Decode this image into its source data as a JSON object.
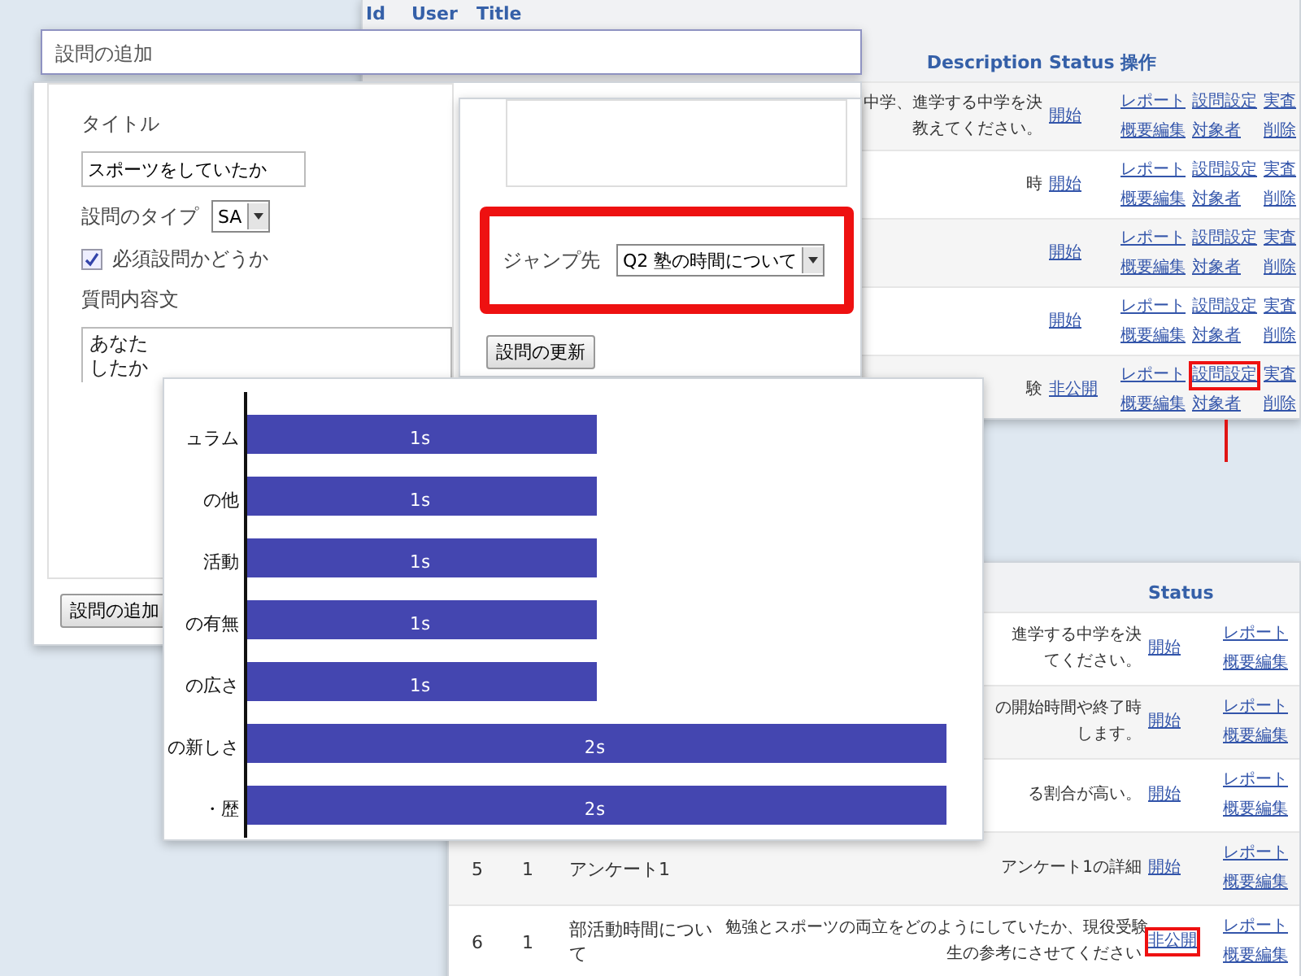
{
  "back_table": {
    "columns": [
      "Id",
      "User",
      "Title",
      "Description",
      "Status",
      "操作"
    ],
    "rows": [
      {
        "description": [
          "中学、進学する中学を決",
          "教えてください。"
        ],
        "status": {
          "label": "開始",
          "highlighted": false
        },
        "actions": [
          {
            "label": "レポート",
            "highlighted": false
          },
          {
            "label": "概要編集",
            "highlighted": false
          },
          {
            "label": "設問設定",
            "highlighted": false
          },
          {
            "label": "対象者",
            "highlighted": false
          },
          {
            "label": "実査",
            "highlighted": false
          },
          {
            "label": "削除",
            "highlighted": false
          }
        ]
      },
      {
        "description": [
          "時"
        ],
        "status": {
          "label": "開始",
          "highlighted": false
        },
        "actions": [
          {
            "label": "レポート",
            "highlighted": false
          },
          {
            "label": "概要編集",
            "highlighted": false
          },
          {
            "label": "設問設定",
            "highlighted": false
          },
          {
            "label": "対象者",
            "highlighted": false
          },
          {
            "label": "実査",
            "highlighted": false
          },
          {
            "label": "削除",
            "highlighted": false
          }
        ]
      },
      {
        "status": {
          "label": "開始",
          "highlighted": false
        },
        "actions": [
          {
            "label": "レポート",
            "highlighted": false
          },
          {
            "label": "概要編集",
            "highlighted": false
          },
          {
            "label": "設問設定",
            "highlighted": false
          },
          {
            "label": "対象者",
            "highlighted": false
          },
          {
            "label": "実査",
            "highlighted": false
          },
          {
            "label": "削除",
            "highlighted": false
          }
        ]
      },
      {
        "status": {
          "label": "開始",
          "highlighted": false
        },
        "actions": [
          {
            "label": "レポート",
            "highlighted": false
          },
          {
            "label": "概要編集",
            "highlighted": false
          },
          {
            "label": "設問設定",
            "highlighted": false
          },
          {
            "label": "対象者",
            "highlighted": false
          },
          {
            "label": "実査",
            "highlighted": false
          },
          {
            "label": "削除",
            "highlighted": false
          }
        ]
      },
      {
        "description": [
          "験"
        ],
        "status": {
          "label": "非公開",
          "highlighted": false
        },
        "actions": [
          {
            "label": "レポート",
            "highlighted": false
          },
          {
            "label": "概要編集",
            "highlighted": false
          },
          {
            "label": "設問設定",
            "highlighted": true
          },
          {
            "label": "対象者",
            "highlighted": false
          },
          {
            "label": "実査",
            "highlighted": false
          },
          {
            "label": "削除",
            "highlighted": false
          }
        ]
      }
    ]
  },
  "add_question_panel": {
    "title": "設問の追加"
  },
  "question_form": {
    "title_label": "タイトル",
    "title_value": "スポーツをしていたか",
    "type_label": "設問のタイプ",
    "type_value": "SA",
    "required": {
      "label": "必須設問かどうか",
      "checked": true
    },
    "text_label": "質問内容文",
    "text_lines": [
      "あなた",
      "したか"
    ],
    "add_button": "設問の追加"
  },
  "jump_panel": {
    "label": "ジャンプ先",
    "value": "Q2 塾の時間について",
    "highlighted": true,
    "update_button": "設問の更新"
  },
  "chart_panel": {
    "chart_data": {
      "type": "bar",
      "orientation": "horizontal",
      "categories": [
        "ュラム",
        "の他",
        "活動",
        "の有無",
        "の広さ",
        "の新しさ",
        "・歴"
      ],
      "values": [
        1,
        1,
        1,
        1,
        1,
        2,
        2
      ],
      "value_labels": [
        "1s",
        "1s",
        "1s",
        "1s",
        "1s",
        "2s",
        "2s"
      ]
    }
  },
  "bottom_table": {
    "status_heading": "Status",
    "rows": [
      {
        "description": [
          "進学する中学を決",
          "てください。"
        ],
        "status": {
          "label": "開始",
          "highlighted": false
        },
        "actions": [
          {
            "label": "レポート",
            "highlighted": false
          },
          {
            "label": "概要編集",
            "highlighted": false
          }
        ]
      },
      {
        "description": [
          "の開始時間や終了時",
          "します。"
        ],
        "status": {
          "label": "開始",
          "highlighted": false
        },
        "actions": [
          {
            "label": "レポート",
            "highlighted": false
          },
          {
            "label": "概要編集",
            "highlighted": false
          }
        ]
      },
      {
        "description": [
          "る割合が高い。"
        ],
        "status": {
          "label": "開始",
          "highlighted": false
        },
        "actions": [
          {
            "label": "レポート",
            "highlighted": false
          },
          {
            "label": "概要編集",
            "highlighted": false
          }
        ]
      },
      {
        "id": "5",
        "user": "1",
        "title": "アンケート1",
        "description": [
          "アンケート1の詳細"
        ],
        "status": {
          "label": "開始",
          "highlighted": false
        },
        "actions": [
          {
            "label": "レポート",
            "highlighted": false
          },
          {
            "label": "概要編集",
            "highlighted": false
          }
        ]
      },
      {
        "id": "6",
        "user": "1",
        "title": "部活動時間について",
        "description": [
          "勉強とスポーツの両立をどのようにしていたか、現役受験",
          "生の参考にさせてください"
        ],
        "status": {
          "label": "非公開",
          "highlighted": true
        },
        "actions": [
          {
            "label": "レポート",
            "highlighted": false
          },
          {
            "label": "概要編集",
            "highlighted": false
          }
        ]
      }
    ]
  }
}
